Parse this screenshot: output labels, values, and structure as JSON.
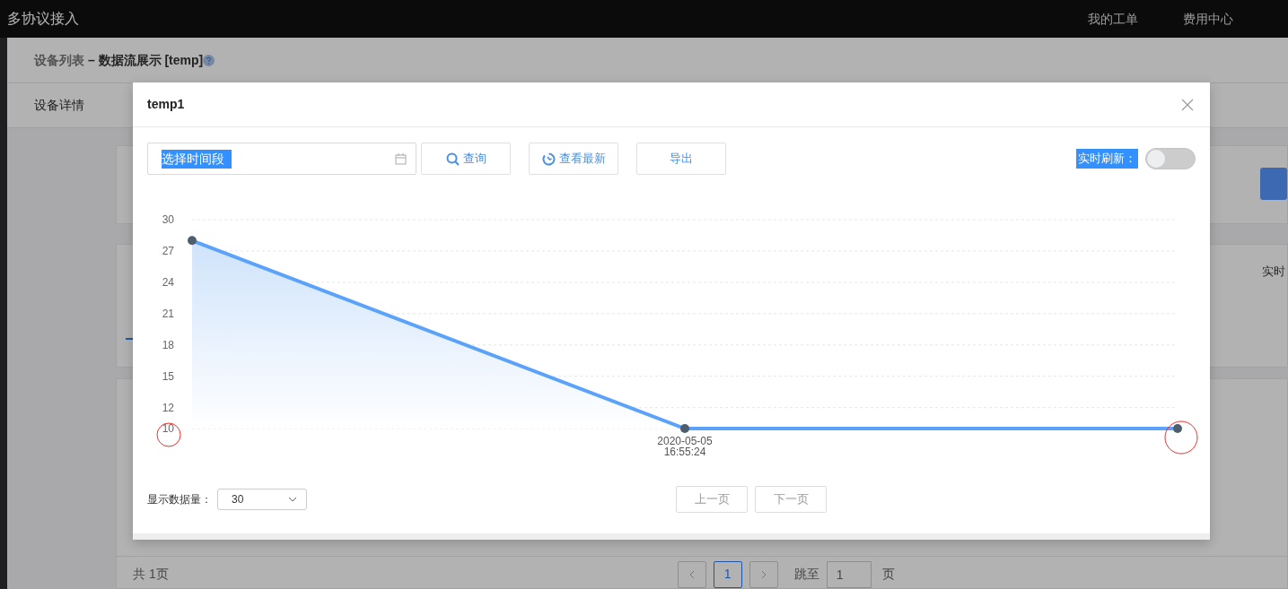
{
  "navbar": {
    "brand": "多协议接入",
    "links": [
      "我的工单",
      "费用中心"
    ]
  },
  "breadcrumb": {
    "parent": "设备列表",
    "separator": "–",
    "current": "数据流展示 [temp]"
  },
  "page_tab": "设备详情",
  "card_2": {
    "label_fragment": "实时"
  },
  "footer": {
    "total": "共 1页",
    "pages": [
      {
        "label": "1",
        "selected": true
      }
    ],
    "jump_label": "跳至",
    "jump_value": "1",
    "jump_suffix": "页"
  },
  "modal": {
    "title": "temp1",
    "date_field": {
      "value": "选择时间段",
      "highlighted": true
    },
    "buttons": [
      {
        "label": "查询"
      },
      {
        "label": "查看最新"
      },
      {
        "label": "导出"
      }
    ],
    "live_refresh": {
      "label": "实时刷新：",
      "highlighted": true,
      "on": false
    },
    "chart_data": {
      "type": "area",
      "categories": [
        null,
        "2020-05-05 16:55:24",
        null
      ],
      "ylim": [
        10,
        30
      ],
      "yticks": [
        {
          "value": 10,
          "label": "10"
        },
        {
          "value": 12,
          "label": "12"
        },
        {
          "value": 15,
          "label": "15"
        },
        {
          "value": 18,
          "label": "18"
        },
        {
          "value": 21,
          "label": "21"
        },
        {
          "value": 24,
          "label": "24"
        },
        {
          "value": 27,
          "label": "27"
        },
        {
          "value": 30,
          "label": "30"
        }
      ],
      "grid": true,
      "series": [
        {
          "color": "#5aa2fa",
          "values": [
            28,
            10,
            10
          ]
        }
      ]
    },
    "markup_circles": {
      "around_axis_min_label": true,
      "around_last_point": true
    },
    "count_label": "显示数据量：",
    "count_select": "30",
    "pager": [
      {
        "label": "上一页",
        "disabled": true
      },
      {
        "label": "下一页",
        "disabled": true
      }
    ]
  }
}
